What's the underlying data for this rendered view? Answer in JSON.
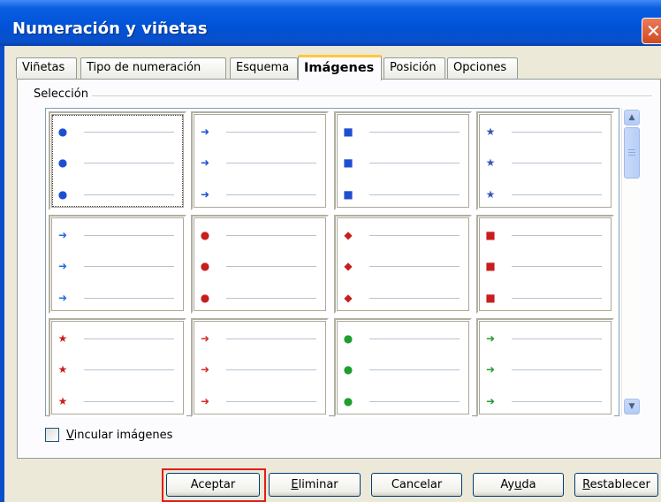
{
  "window": {
    "title": "Numeración y viñetas",
    "close_glyph": "✕"
  },
  "tabs": [
    {
      "label": "Viñetas",
      "active": false
    },
    {
      "label": "Tipo de numeración",
      "active": false
    },
    {
      "label": "Esquema",
      "active": false
    },
    {
      "label": "Imágenes",
      "active": true
    },
    {
      "label": "Posición",
      "active": false
    },
    {
      "label": "Opciones",
      "active": false
    }
  ],
  "selection": {
    "label": "Selección",
    "selected_index": 0,
    "cells": [
      {
        "icon": "blue-sphere-icon",
        "glyph": "●",
        "color": "#1f4fd1"
      },
      {
        "icon": "blue-arrow-icon",
        "glyph": "➜",
        "color": "#1f4fd1"
      },
      {
        "icon": "blue-cube-icon",
        "glyph": "■",
        "color": "#1f4fd1"
      },
      {
        "icon": "blue-star-icon",
        "glyph": "★",
        "color": "#3a57b8"
      },
      {
        "icon": "blue-arrow-icon",
        "glyph": "➜",
        "color": "#1f6fe0"
      },
      {
        "icon": "red-sphere-icon",
        "glyph": "●",
        "color": "#c81e1e"
      },
      {
        "icon": "red-diamond-arrow-icon",
        "glyph": "◆",
        "color": "#c81e1e"
      },
      {
        "icon": "red-cube-icon",
        "glyph": "■",
        "color": "#c81e1e"
      },
      {
        "icon": "red-star-icon",
        "glyph": "★",
        "color": "#c81e1e"
      },
      {
        "icon": "red-arrow-icon",
        "glyph": "➜",
        "color": "#d42a2a"
      },
      {
        "icon": "green-sphere-icon",
        "glyph": "●",
        "color": "#1e9e2e"
      },
      {
        "icon": "green-arrow-icon",
        "glyph": "➜",
        "color": "#1e9e2e"
      }
    ]
  },
  "checkbox": {
    "label_rest": "incular imágenes",
    "accesskey": "V",
    "checked": false
  },
  "buttons": {
    "ok": "Aceptar",
    "delete_key": "E",
    "delete_rest": "liminar",
    "cancel": "Cancelar",
    "help_pre": "Ay",
    "help_key": "u",
    "help_post": "da",
    "reset_key": "R",
    "reset_rest": "establecer"
  }
}
